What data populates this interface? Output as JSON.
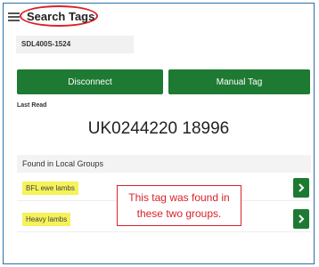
{
  "header": {
    "title": "Search Tags",
    "menu_icon": "hamburger-menu-icon"
  },
  "device": {
    "name": "SDL400S-1524"
  },
  "actions": {
    "disconnect_label": "Disconnect",
    "manual_tag_label": "Manual Tag"
  },
  "last_read": {
    "label": "Last Read",
    "value": "UK0244220 18996"
  },
  "groups": {
    "header": "Found in Local Groups",
    "items": [
      {
        "label": "BFL ewe lambs",
        "action_icon": "chevron-right-icon"
      },
      {
        "label": "Heavy lambs",
        "action_icon": "chevron-right-icon"
      }
    ]
  },
  "annotation": {
    "line1": "This tag was found in",
    "line2": "these two groups."
  },
  "colors": {
    "primary_green": "#1e7a32",
    "highlight_yellow": "#f5f25a",
    "annotation_red": "#d9222a",
    "frame_blue": "#2f6ea6"
  }
}
